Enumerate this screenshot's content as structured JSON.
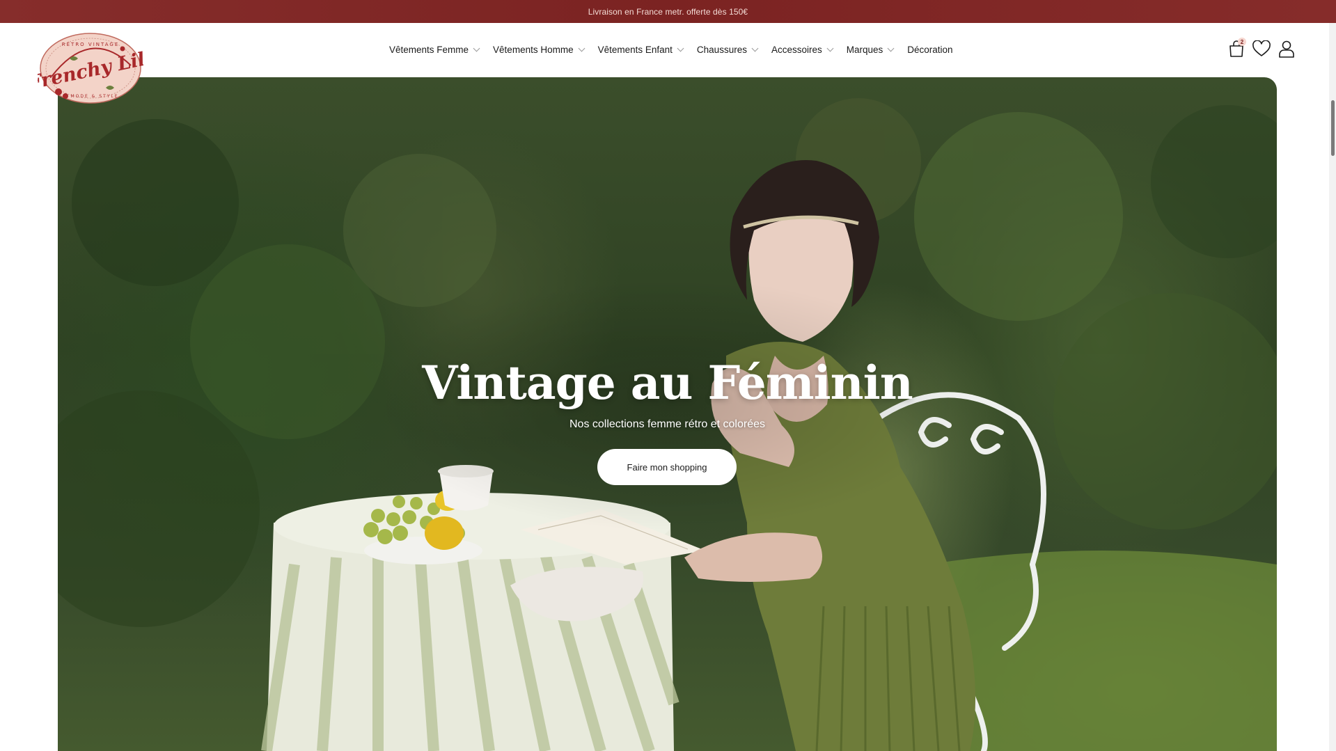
{
  "announcement": {
    "text": "Livraison en France metr. offerte dès 150€"
  },
  "logo": {
    "text": "Frenchy Lili",
    "arc_top": "RÉTRO VINTAGE",
    "arc_bottom": "MODE & STYLE"
  },
  "nav": {
    "items": [
      {
        "label": "Vêtements Femme",
        "has_dropdown": true
      },
      {
        "label": "Vêtements Homme",
        "has_dropdown": true
      },
      {
        "label": "Vêtements Enfant",
        "has_dropdown": true
      },
      {
        "label": "Chaussures",
        "has_dropdown": true
      },
      {
        "label": "Accessoires",
        "has_dropdown": true
      },
      {
        "label": "Marques",
        "has_dropdown": true
      },
      {
        "label": "Décoration",
        "has_dropdown": false
      }
    ]
  },
  "header_icons": {
    "cart": {
      "icon": "shopping-bag-icon",
      "count": "2"
    },
    "wishlist": {
      "icon": "heart-icon"
    },
    "account": {
      "icon": "user-icon"
    }
  },
  "hero": {
    "title": "Vintage au Féminin",
    "subtitle": "Nos collections femme rétro et colorées",
    "button": "Faire mon shopping"
  },
  "colors": {
    "announcement_bg": "#7b2322",
    "announcement_text": "#f4dcd6",
    "logo_red": "#a8282a",
    "logo_bg": "#f3d3c8",
    "foliage": "#3b4e2b"
  }
}
